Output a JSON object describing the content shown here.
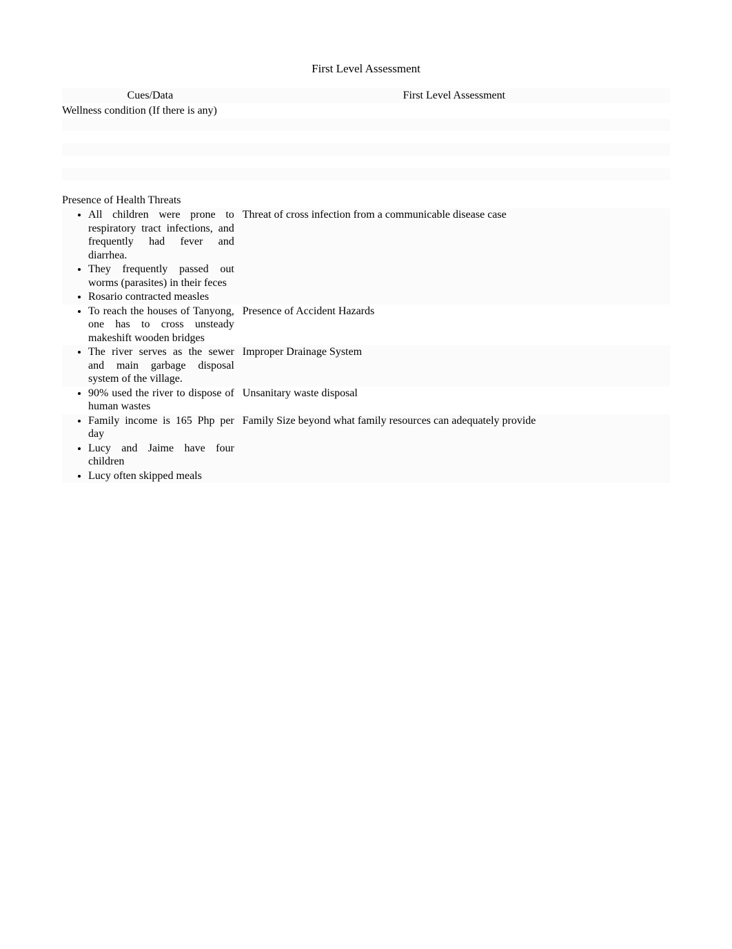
{
  "title": "First Level Assessment",
  "tableHeaders": {
    "cues": "Cues/Data",
    "assessment": "First Level Assessment"
  },
  "wellnessRow": "Wellness condition (If there is any)",
  "healthThreatsHeading": "Presence of Health Threats",
  "rows": [
    {
      "bullets": [
        "All children were prone to respiratory tract infections, and frequently had fever and diarrhea.",
        "They frequently passed out worms (parasites) in their feces",
        "Rosario contracted measles"
      ],
      "assessment": "Threat of cross infection from a communicable disease case"
    },
    {
      "bullets": [
        "To reach the houses of Tanyong, one has to cross unsteady makeshift wooden bridges"
      ],
      "assessment": "Presence of Accident Hazards"
    },
    {
      "bullets": [
        "The river serves as the sewer and main garbage disposal system of the village."
      ],
      "assessment": "Improper Drainage System"
    },
    {
      "bullets": [
        "90% used the river to dispose of human wastes"
      ],
      "assessment": "Unsanitary waste disposal"
    },
    {
      "bullets": [
        "Family income is 165 Php per day",
        "Lucy and Jaime have four children",
        "Lucy often skipped meals"
      ],
      "assessment": "Family Size beyond what family resources can adequately provide"
    }
  ]
}
